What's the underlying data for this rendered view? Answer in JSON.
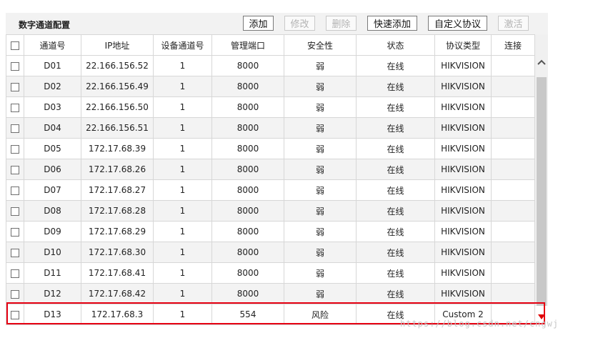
{
  "panel": {
    "title": "数字通道配置",
    "buttons": {
      "add": "添加",
      "modify": "修改",
      "delete": "删除",
      "quick_add": "快速添加",
      "custom_protocol": "自定义协议",
      "activate": "激活"
    }
  },
  "table": {
    "headers": {
      "channel": "通道号",
      "ip": "IP地址",
      "device_channel": "设备通道号",
      "port": "管理端口",
      "security": "安全性",
      "status": "状态",
      "protocol": "协议类型",
      "connect": "连接"
    },
    "rows": [
      {
        "channel": "D01",
        "ip": "22.166.156.52",
        "device_channel": "1",
        "port": "8000",
        "security": "弱",
        "status": "在线",
        "protocol": "HIKVISION",
        "connect": ""
      },
      {
        "channel": "D02",
        "ip": "22.166.156.49",
        "device_channel": "1",
        "port": "8000",
        "security": "弱",
        "status": "在线",
        "protocol": "HIKVISION",
        "connect": ""
      },
      {
        "channel": "D03",
        "ip": "22.166.156.50",
        "device_channel": "1",
        "port": "8000",
        "security": "弱",
        "status": "在线",
        "protocol": "HIKVISION",
        "connect": ""
      },
      {
        "channel": "D04",
        "ip": "22.166.156.51",
        "device_channel": "1",
        "port": "8000",
        "security": "弱",
        "status": "在线",
        "protocol": "HIKVISION",
        "connect": ""
      },
      {
        "channel": "D05",
        "ip": "172.17.68.39",
        "device_channel": "1",
        "port": "8000",
        "security": "弱",
        "status": "在线",
        "protocol": "HIKVISION",
        "connect": ""
      },
      {
        "channel": "D06",
        "ip": "172.17.68.26",
        "device_channel": "1",
        "port": "8000",
        "security": "弱",
        "status": "在线",
        "protocol": "HIKVISION",
        "connect": ""
      },
      {
        "channel": "D07",
        "ip": "172.17.68.27",
        "device_channel": "1",
        "port": "8000",
        "security": "弱",
        "status": "在线",
        "protocol": "HIKVISION",
        "connect": ""
      },
      {
        "channel": "D08",
        "ip": "172.17.68.28",
        "device_channel": "1",
        "port": "8000",
        "security": "弱",
        "status": "在线",
        "protocol": "HIKVISION",
        "connect": ""
      },
      {
        "channel": "D09",
        "ip": "172.17.68.29",
        "device_channel": "1",
        "port": "8000",
        "security": "弱",
        "status": "在线",
        "protocol": "HIKVISION",
        "connect": ""
      },
      {
        "channel": "D10",
        "ip": "172.17.68.30",
        "device_channel": "1",
        "port": "8000",
        "security": "弱",
        "status": "在线",
        "protocol": "HIKVISION",
        "connect": ""
      },
      {
        "channel": "D11",
        "ip": "172.17.68.41",
        "device_channel": "1",
        "port": "8000",
        "security": "弱",
        "status": "在线",
        "protocol": "HIKVISION",
        "connect": ""
      },
      {
        "channel": "D12",
        "ip": "172.17.68.42",
        "device_channel": "1",
        "port": "8000",
        "security": "弱",
        "status": "在线",
        "protocol": "HIKVISION",
        "connect": ""
      },
      {
        "channel": "D13",
        "ip": "172.17.68.3",
        "device_channel": "1",
        "port": "554",
        "security": "风险",
        "status": "在线",
        "protocol": "Custom 2",
        "connect": ""
      }
    ]
  },
  "icons": {
    "scroll_up": "chevron-up-icon",
    "scroll_down": "triangle-down-icon"
  },
  "colors": {
    "highlight": "#e60012",
    "row_alt": "#f3f3f3",
    "toolbar": "#f2f2f2"
  },
  "watermark": "https://blog.csdn.net/cngwj"
}
